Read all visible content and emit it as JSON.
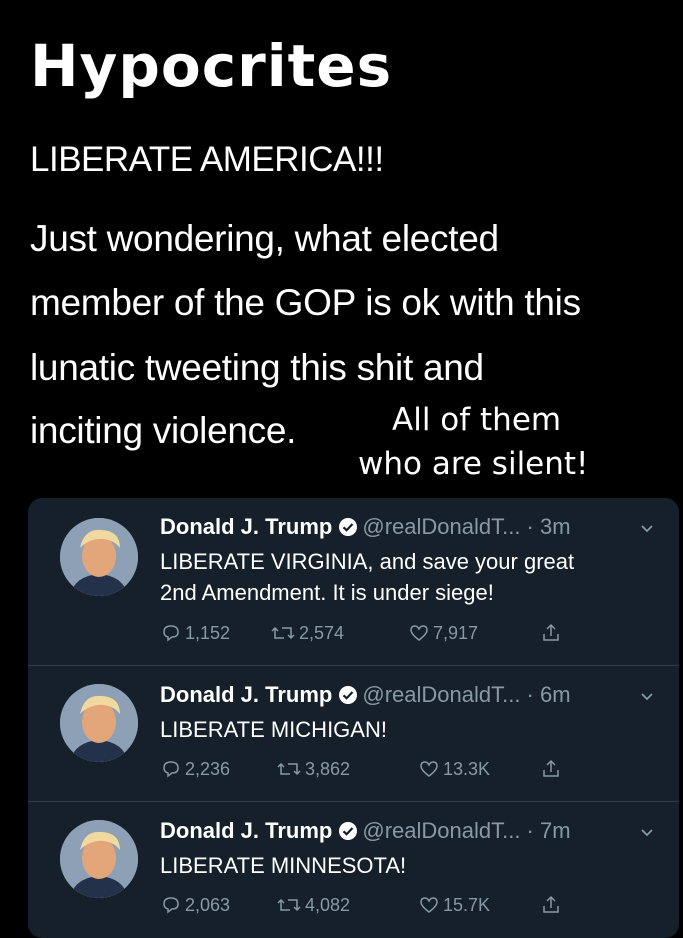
{
  "overlay": {
    "title": "Hypocrites",
    "note_line1": "All of them",
    "note_line2": "who are silent!"
  },
  "post": {
    "headline": "LIBERATE AMERICA!!!",
    "lines": [
      "Just wondering, what elected",
      "member of the GOP is ok with this",
      "lunatic tweeting this shit and",
      "inciting violence."
    ]
  },
  "tweets": [
    {
      "name": "Donald J. Trump",
      "handle_time": "@realDonaldT... · 3m",
      "text_lines": [
        "LIBERATE VIRGINIA, and save your great",
        "2nd Amendment. It is under siege!"
      ],
      "replies": "1,152",
      "retweets": "2,574",
      "likes": "7,917"
    },
    {
      "name": "Donald J. Trump",
      "handle_time": "@realDonaldT... · 6m",
      "text_lines": [
        "LIBERATE MICHIGAN!"
      ],
      "replies": "2,236",
      "retweets": "3,862",
      "likes": "13.3K"
    },
    {
      "name": "Donald J. Trump",
      "handle_time": "@realDonaldT... · 7m",
      "text_lines": [
        "LIBERATE MINNESOTA!"
      ],
      "replies": "2,063",
      "retweets": "4,082",
      "likes": "15.7K"
    }
  ],
  "icons": {
    "verified": "verified-badge-icon",
    "caret": "chevron-down-icon",
    "reply": "reply-icon",
    "retweet": "retweet-icon",
    "like": "heart-icon",
    "share": "share-icon"
  },
  "colors": {
    "background": "#000000",
    "card": "#15202b",
    "muted": "#8899a6",
    "verified": "#ffffff"
  }
}
